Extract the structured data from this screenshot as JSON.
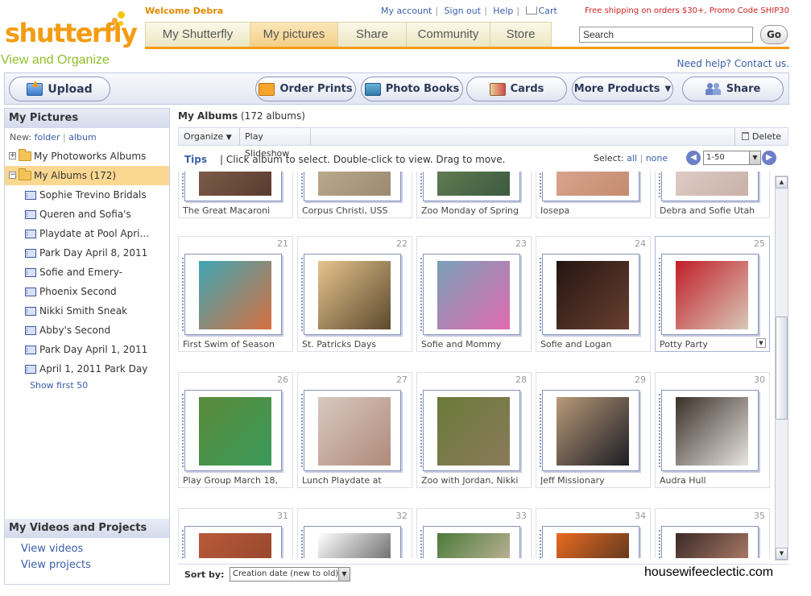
{
  "header": {
    "logo_text": "shutterfly",
    "tagline": "View and Organize",
    "welcome": "Welcome Debra",
    "links": [
      "My account",
      "Sign out",
      "Help",
      "Cart"
    ],
    "promo": "Free shipping on orders $30+, Promo Code SHIP30",
    "help_link": "Need help? Contact us.",
    "search_placeholder": "Search",
    "go_label": "Go",
    "nav_tabs": [
      "My Shutterfly",
      "My pictures",
      "Share",
      "Community",
      "Store"
    ],
    "active_tab": "My pictures"
  },
  "toolbar": {
    "upload": "Upload",
    "order_prints": "Order Prints",
    "photo_books": "Photo Books",
    "cards": "Cards",
    "more_products": "More Products",
    "share": "Share"
  },
  "sidebar": {
    "title": "My Pictures",
    "new_label": "New:",
    "new_folder": "folder",
    "new_album": "album",
    "photoworks": "My Photoworks Albums",
    "my_albums": "My Albums (172)",
    "albums": [
      "Sophie Trevino Bridals",
      "Queren and Sofia's",
      "Playdate at Pool Apri...",
      "Park Day April 8, 2011",
      "Sofie and Emery-",
      "Phoenix Second",
      "Nikki Smith Sneak",
      "Abby's Second",
      "Park Day April 1, 2011",
      "April 1, 2011 Park Day"
    ],
    "show_first": "Show first 50",
    "videos_title": "My Videos and Projects",
    "view_videos": "View videos",
    "view_projects": "View projects"
  },
  "main": {
    "title": "My Albums",
    "count": "(172 albums)",
    "organize": "Organize",
    "play_slideshow": "Play Slideshow",
    "delete": "Delete",
    "tips_label": "Tips",
    "tips_text": "|  Click album to select. Double-click to view. Drag to move.",
    "select_label": "Select:",
    "select_all": "all",
    "select_none": "none",
    "page_range": "1-50",
    "sort_label": "Sort by:",
    "sort_value": "Creation date (new to old)"
  },
  "albums": [
    {
      "num": "",
      "title": "The Great Macaroni",
      "colors": [
        "#8a6a55",
        "#5a3b2e"
      ]
    },
    {
      "num": "",
      "title": "Corpus Christi, USS",
      "colors": [
        "#c9b69a",
        "#9b8a70"
      ]
    },
    {
      "num": "",
      "title": "Zoo Monday of Spring",
      "colors": [
        "#6f8a5a",
        "#3c5a3f"
      ]
    },
    {
      "num": "",
      "title": "Iosepa",
      "colors": [
        "#e0b098",
        "#c48a70"
      ]
    },
    {
      "num": "",
      "title": "Debra and Sofie Utah",
      "colors": [
        "#e8d8d0",
        "#c8b0a8"
      ]
    },
    {
      "num": "21",
      "title": "First Swim of Season",
      "colors": [
        "#3fa6b4",
        "#d77040"
      ]
    },
    {
      "num": "22",
      "title": "St. Patricks Days",
      "colors": [
        "#e6c38c",
        "#5c4a2e"
      ]
    },
    {
      "num": "23",
      "title": "Sofie and Mommy",
      "colors": [
        "#7aa0b8",
        "#e06ab0"
      ]
    },
    {
      "num": "24",
      "title": "Sofie and Logan",
      "colors": [
        "#241512",
        "#6a4030"
      ]
    },
    {
      "num": "25",
      "title": "Potty Party",
      "colors": [
        "#c21e28",
        "#d8c8b8"
      ]
    },
    {
      "num": "26",
      "title": "Play Group March 18,",
      "colors": [
        "#5a8a3a",
        "#3a9a5a"
      ]
    },
    {
      "num": "27",
      "title": "Lunch Playdate at",
      "colors": [
        "#d8c8c0",
        "#b08a7a"
      ]
    },
    {
      "num": "28",
      "title": "Zoo with Jordan, Nikki",
      "colors": [
        "#6a7a3a",
        "#8a7a5a"
      ]
    },
    {
      "num": "29",
      "title": "Jeff Missionary",
      "colors": [
        "#b89a78",
        "#1c1c24"
      ]
    },
    {
      "num": "30",
      "title": "Audra Hull",
      "colors": [
        "#3a3028",
        "#e8e4e0"
      ]
    },
    {
      "num": "31",
      "title": "",
      "colors": [
        "#b85a3a",
        "#8a4028"
      ]
    },
    {
      "num": "32",
      "title": "",
      "colors": [
        "#ffffff",
        "#333333"
      ]
    },
    {
      "num": "33",
      "title": "",
      "colors": [
        "#4a7a3a",
        "#e8c8b8"
      ]
    },
    {
      "num": "34",
      "title": "",
      "colors": [
        "#e86a20",
        "#2a2420"
      ]
    },
    {
      "num": "35",
      "title": "",
      "colors": [
        "#3a2a28",
        "#d89a80"
      ]
    }
  ],
  "watermark": "housewifeeclectic.com"
}
